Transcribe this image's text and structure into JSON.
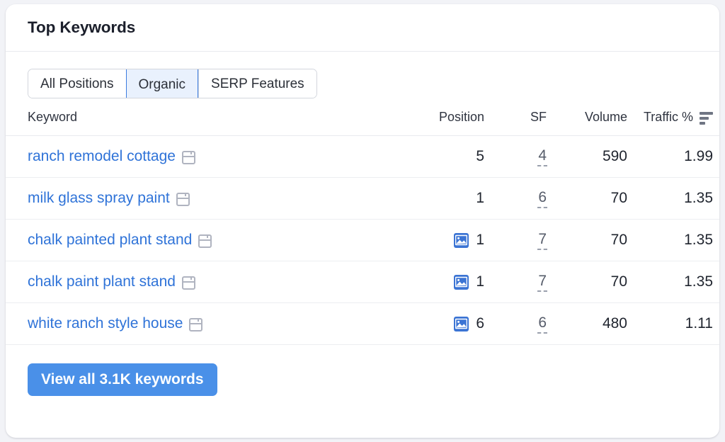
{
  "card": {
    "title": "Top Keywords"
  },
  "tabs": {
    "selected": "Organic",
    "items": [
      {
        "label": "All Positions",
        "selected": false
      },
      {
        "label": "Organic",
        "selected": true
      },
      {
        "label": "SERP Features",
        "selected": false
      }
    ]
  },
  "table": {
    "columns": [
      {
        "key": "keyword",
        "label": "Keyword"
      },
      {
        "key": "position",
        "label": "Position"
      },
      {
        "key": "sf",
        "label": "SF"
      },
      {
        "key": "volume",
        "label": "Volume"
      },
      {
        "key": "traffic",
        "label": "Traffic %"
      }
    ],
    "sort": {
      "column": "Traffic %",
      "icon": "sort-descending-bars-icon",
      "direction": "desc"
    },
    "rows": [
      {
        "keyword": "ranch remodel cottage",
        "keyword_icon": "serp-preview-icon",
        "position": "5",
        "position_feature_icon": null,
        "sf": "4",
        "volume": "590",
        "traffic": "1.99"
      },
      {
        "keyword": "milk glass spray paint",
        "keyword_icon": "serp-preview-icon",
        "position": "1",
        "position_feature_icon": null,
        "sf": "6",
        "volume": "70",
        "traffic": "1.35"
      },
      {
        "keyword": "chalk painted plant stand",
        "keyword_icon": "serp-preview-icon",
        "position": "1",
        "position_feature_icon": "image-pack-icon",
        "sf": "7",
        "volume": "70",
        "traffic": "1.35"
      },
      {
        "keyword": "chalk paint plant stand",
        "keyword_icon": "serp-preview-icon",
        "position": "1",
        "position_feature_icon": "image-pack-icon",
        "sf": "7",
        "volume": "70",
        "traffic": "1.35"
      },
      {
        "keyword": "white ranch style house",
        "keyword_icon": "serp-preview-icon",
        "position": "6",
        "position_feature_icon": "image-pack-icon",
        "sf": "6",
        "volume": "480",
        "traffic": "1.11"
      }
    ]
  },
  "footer": {
    "view_all_label": "View all 3.1K keywords"
  },
  "colors": {
    "page_background": "#f2f3f7",
    "card_background": "#ffffff",
    "link": "#2f73d8",
    "primary_button": "#4a90e8",
    "selected_tab_border": "#3c7ce0",
    "selected_tab_fill": "#e9f1fd",
    "feature_badge": "#3b74d4",
    "divider": "#e8eaee"
  }
}
